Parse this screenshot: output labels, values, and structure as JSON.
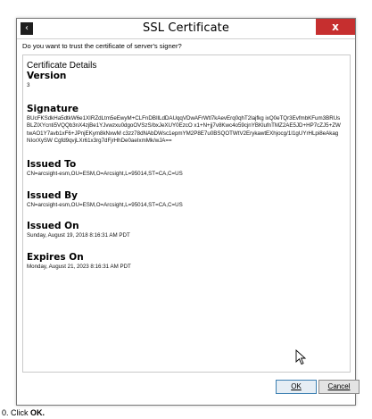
{
  "window": {
    "title": "SSL Certificate",
    "icon": "terminal-icon",
    "close_label": "x"
  },
  "question": "Do you want to trust the certificate of server's signer?",
  "details": {
    "heading": "Certificate Details",
    "version": {
      "label": "Version",
      "value": "3"
    },
    "signature": {
      "label": "Signature",
      "value": "BUcFKSdkHa5dtkW6e1XIRZdLtm5eEwyM+CLFnDBIlLdDAUqqVDwAFrWtl7kAevErq0qhT2lajfkg ixQ0eTQr3EvfmbKFum3BRUsBLZlXYcnti5VQQb3nX4zjBe1YJvwzxu0dgoOVSzS/bxJeXUY0EzcO x1+N+jj7v8Kwc4o59cjnYBKlufnTMZ2AE5JD+HP7cZJ5+ZWtwAO1Y7avb1xF6+JPnjEKym8kNxwM c3zz78dNAbDWsc1epmYM2P8E7u0BSQOTWtV2ErykawtEXhjocg/1I1gUYrHLpi8eAkagNIorXySW Cgfd9qvjLXr61x3rg7dFjrHhDe0aeIxmMk/wJA=="
    },
    "issued_to": {
      "label": "Issued To",
      "value": "CN=arcsight-esm,OU=ESM,O=Arcsight,L=95014,ST=CA,C=US"
    },
    "issued_by": {
      "label": "Issued By",
      "value": "CN=arcsight-esm,OU=ESM,O=Arcsight,L=95014,ST=CA,C=US"
    },
    "issued_on": {
      "label": "Issued On",
      "value": "Sunday, August 19, 2018 8:16:31 AM PDT"
    },
    "expires_on": {
      "label": "Expires On",
      "value": "Monday, August 21, 2023 8:16:31 AM PDT"
    }
  },
  "buttons": {
    "ok": "OK",
    "cancel": "Cancel"
  },
  "caption": {
    "prefix": "0. Click ",
    "bold": "OK."
  },
  "colors": {
    "close": "#c62f2f",
    "focus_border": "#3c7fb1"
  }
}
